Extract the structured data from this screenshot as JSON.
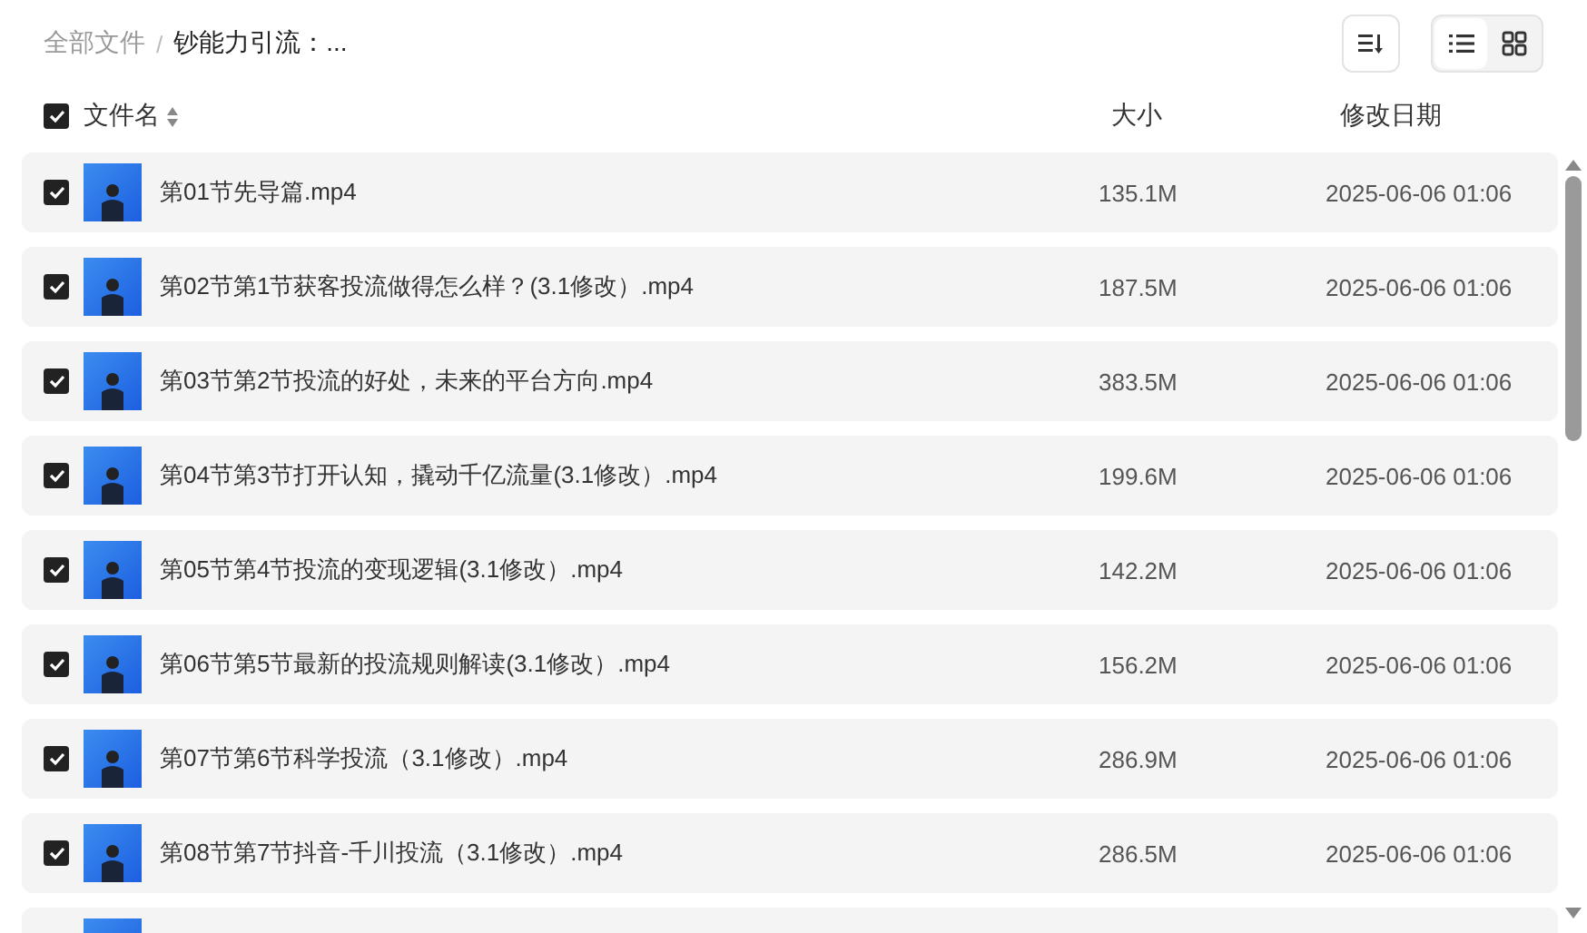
{
  "breadcrumb_separator": "/",
  "breadcrumb": [
    {
      "label": "全部文件",
      "current": false
    },
    {
      "label": "钞能力引流：...",
      "current": true
    }
  ],
  "view_modes": [
    {
      "kind": "list",
      "selected": true
    },
    {
      "kind": "grid",
      "selected": false
    }
  ],
  "header": {
    "checked": true,
    "columns": [
      "文件名",
      "大小",
      "修改日期"
    ]
  },
  "files": [
    {
      "checked": true,
      "name": "第01节先导篇.mp4",
      "size": "135.1M",
      "modified": "2025-06-06 01:06"
    },
    {
      "checked": true,
      "name": "第02节第1节获客投流做得怎么样？(3.1修改）.mp4",
      "size": "187.5M",
      "modified": "2025-06-06 01:06"
    },
    {
      "checked": true,
      "name": "第03节第2节投流的好处，未来的平台方向.mp4",
      "size": "383.5M",
      "modified": "2025-06-06 01:06"
    },
    {
      "checked": true,
      "name": "第04节第3节打开认知，撬动千亿流量(3.1修改）.mp4",
      "size": "199.6M",
      "modified": "2025-06-06 01:06"
    },
    {
      "checked": true,
      "name": "第05节第4节投流的变现逻辑(3.1修改）.mp4",
      "size": "142.2M",
      "modified": "2025-06-06 01:06"
    },
    {
      "checked": true,
      "name": "第06节第5节最新的投流规则解读(3.1修改）.mp4",
      "size": "156.2M",
      "modified": "2025-06-06 01:06"
    },
    {
      "checked": true,
      "name": "第07节第6节科学投流（3.1修改）.mp4",
      "size": "286.9M",
      "modified": "2025-06-06 01:06"
    },
    {
      "checked": true,
      "name": "第08节第7节抖音-千川投流（3.1修改）.mp4",
      "size": "286.5M",
      "modified": "2025-06-06 01:06"
    }
  ]
}
